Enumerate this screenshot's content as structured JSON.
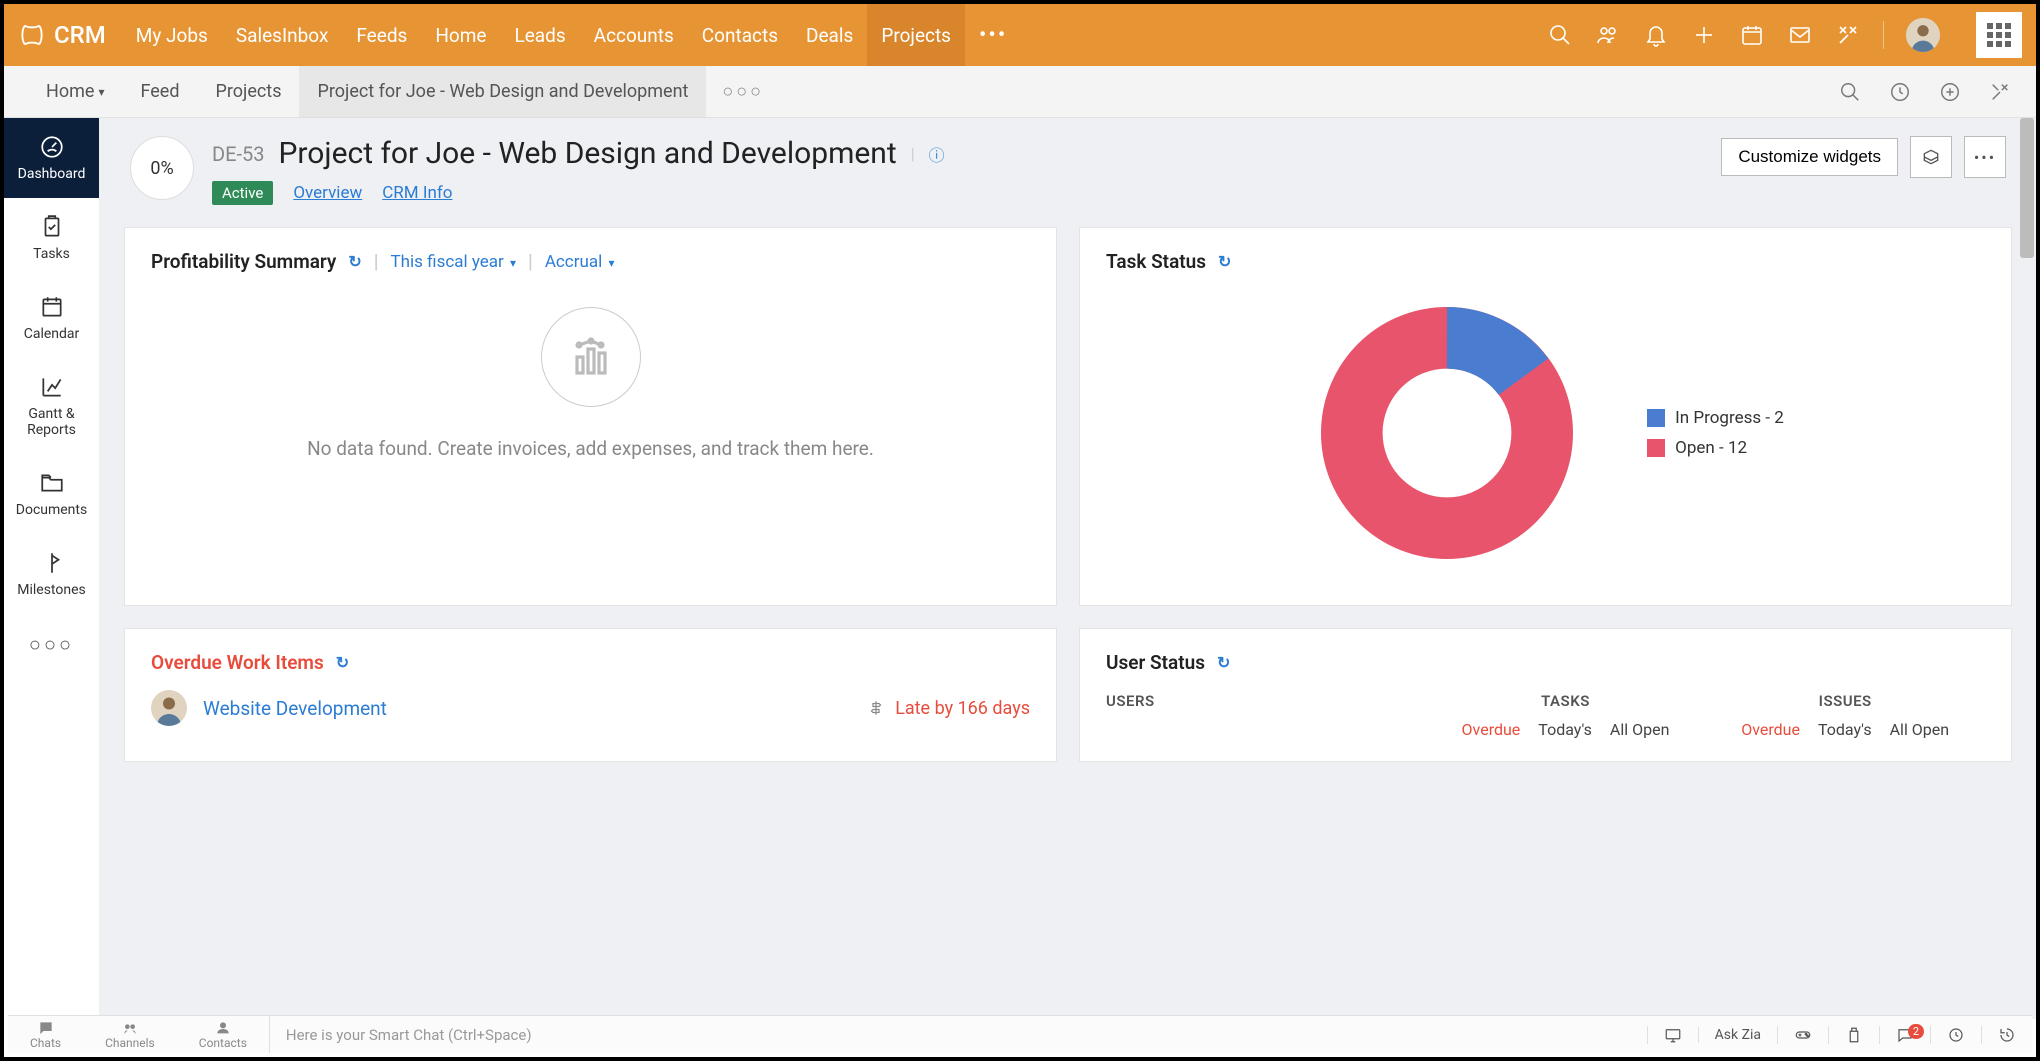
{
  "brand": "CRM",
  "topnav": [
    "My Jobs",
    "SalesInbox",
    "Feeds",
    "Home",
    "Leads",
    "Accounts",
    "Contacts",
    "Deals",
    "Projects"
  ],
  "topnav_active_index": 8,
  "subnav": {
    "items": [
      "Home",
      "Feed",
      "Projects"
    ],
    "active_crumb": "Project for Joe - Web Design and Development"
  },
  "rail": [
    {
      "label": "Dashboard",
      "icon": "gauge"
    },
    {
      "label": "Tasks",
      "icon": "clipboard"
    },
    {
      "label": "Calendar",
      "icon": "calendar"
    },
    {
      "label": "Gantt & Reports",
      "icon": "chart"
    },
    {
      "label": "Documents",
      "icon": "folder"
    },
    {
      "label": "Milestones",
      "icon": "flag"
    }
  ],
  "rail_active_index": 0,
  "project": {
    "progress": "0%",
    "code": "DE-53",
    "title": "Project for Joe - Web Design and Development",
    "status_badge": "Active",
    "links": [
      "Overview",
      "CRM Info"
    ],
    "customize_btn": "Customize widgets"
  },
  "widgets": {
    "profitability": {
      "title": "Profitability Summary",
      "filter1": "This fiscal year",
      "filter2": "Accrual",
      "empty_text": "No data found. Create invoices, add expenses, and track them here."
    },
    "task_status": {
      "title": "Task Status",
      "legend": [
        {
          "label": "In Progress - 2",
          "color": "#4a7dcf"
        },
        {
          "label": "Open - 12",
          "color": "#e8546b"
        }
      ]
    },
    "overdue": {
      "title": "Overdue Work Items",
      "item_name": "Website Development",
      "late_text": "Late by 166 days"
    },
    "user_status": {
      "title": "User Status",
      "cols": [
        "USERS",
        "TASKS",
        "ISSUES"
      ],
      "subcols": [
        "Overdue",
        "Today's",
        "All Open",
        "Overdue",
        "Today's",
        "All Open"
      ]
    }
  },
  "chart_data": {
    "type": "pie",
    "title": "Task Status",
    "series": [
      {
        "name": "In Progress",
        "value": 2,
        "color": "#4a7dcf"
      },
      {
        "name": "Open",
        "value": 12,
        "color": "#e8546b"
      }
    ]
  },
  "bottombar": {
    "left": [
      "Chats",
      "Channels",
      "Contacts"
    ],
    "placeholder": "Here is your Smart Chat (Ctrl+Space)",
    "ask": "Ask Zia",
    "badge": "2"
  }
}
